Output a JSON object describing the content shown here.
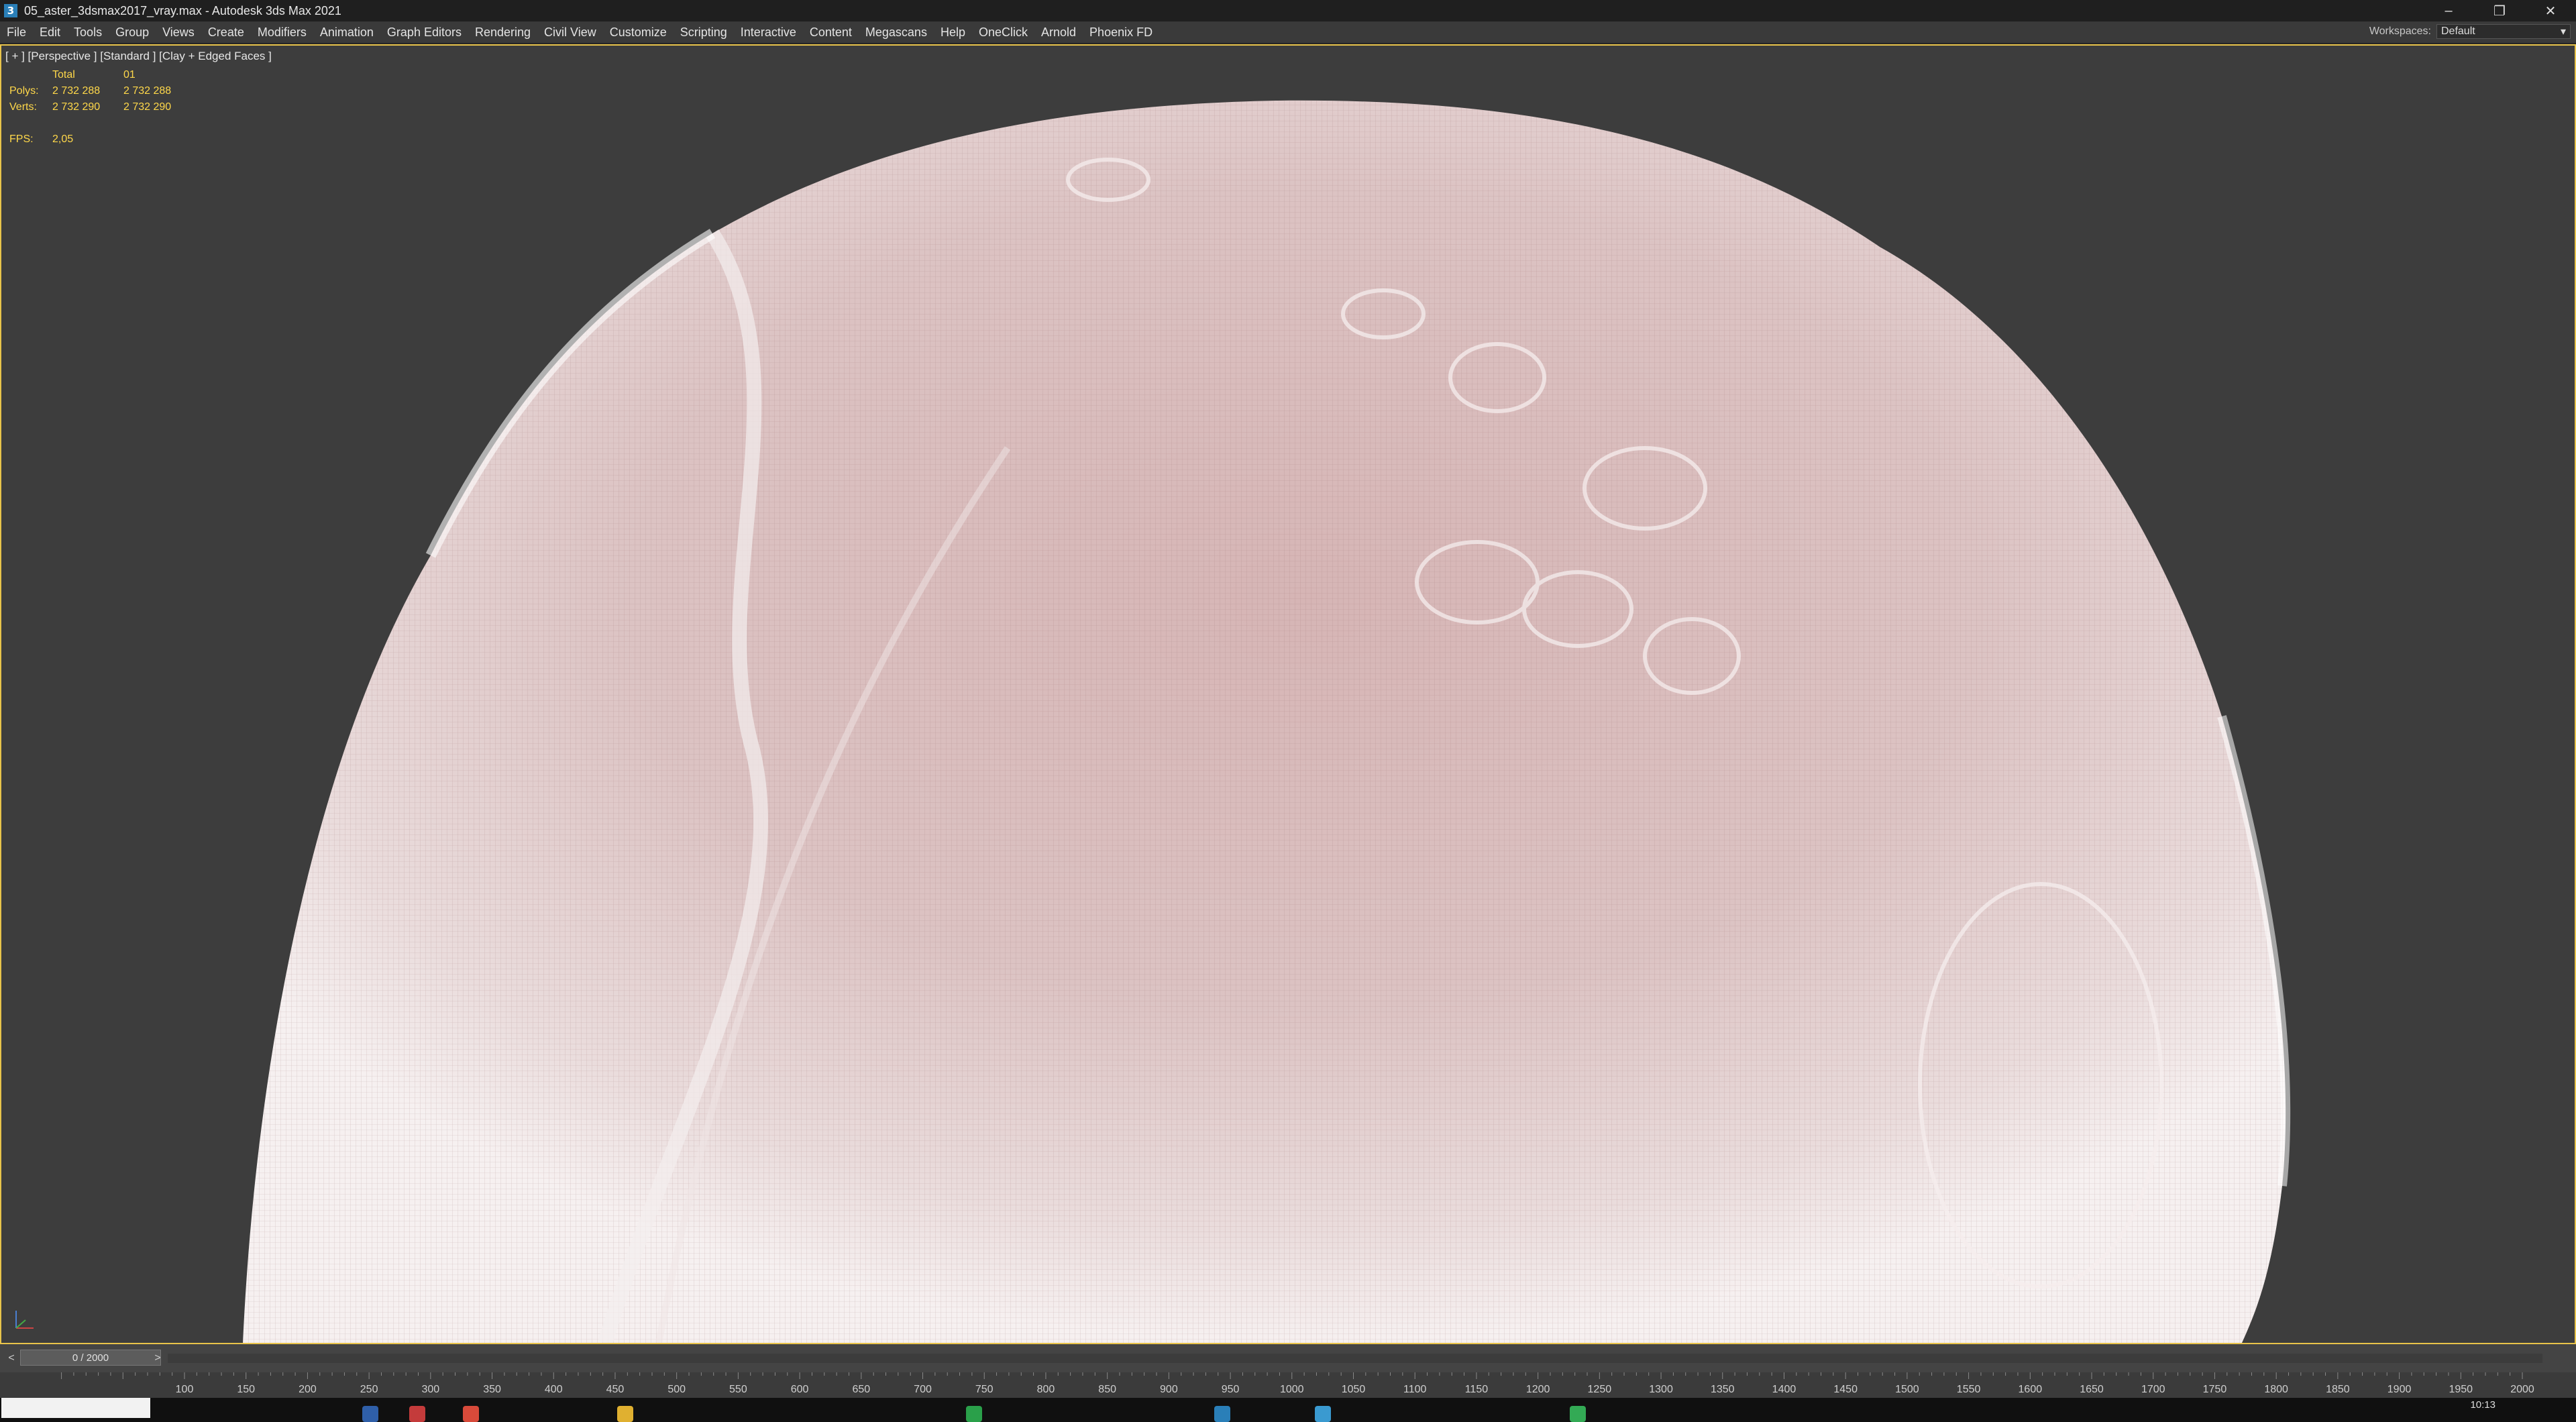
{
  "window": {
    "title": "05_aster_3dsmax2017_vray.max - Autodesk 3ds Max 2021",
    "app_icon_letter": "3",
    "controls": [
      "–",
      "❐",
      "✕"
    ]
  },
  "menubar": {
    "items": [
      "File",
      "Edit",
      "Tools",
      "Group",
      "Views",
      "Create",
      "Modifiers",
      "Animation",
      "Graph Editors",
      "Rendering",
      "Civil View",
      "Customize",
      "Scripting",
      "Interactive",
      "Content",
      "Megascans",
      "Help",
      "OneClick",
      "Arnold",
      "Phoenix FD"
    ],
    "workspaces_label": "Workspaces:",
    "workspace_value": "Default"
  },
  "viewport": {
    "label": "[ + ] [Perspective ] [Standard ] [Clay + Edged Faces ]",
    "stats": {
      "header_total": "Total",
      "header_obj": "01",
      "polys_label": "Polys:",
      "polys_total": "2 732 288",
      "polys_obj": "2 732 288",
      "verts_label": "Verts:",
      "verts_total": "2 732 290",
      "verts_obj": "2 732 290",
      "fps_label": "FPS:",
      "fps_value": "2,05"
    },
    "object_color": "#d8bfbf",
    "background_color": "#3d3d3d",
    "border_color": "#e8c34a"
  },
  "timeline": {
    "frame_readout": "0 / 2000",
    "prev_icon": "arrow-left",
    "next_icon": "arrow-right",
    "ruler_labels": [
      "100",
      "150",
      "200",
      "250",
      "300",
      "350",
      "400",
      "450",
      "500",
      "550",
      "600",
      "650",
      "700",
      "750",
      "800",
      "850",
      "900",
      "950",
      "1000",
      "1050",
      "1100",
      "1150",
      "1200",
      "1250",
      "1300",
      "1350",
      "1400",
      "1450",
      "1500",
      "1550",
      "1600",
      "1650",
      "1700",
      "1750",
      "1800",
      "1850",
      "1900",
      "1950",
      "2000"
    ]
  },
  "taskbar": {
    "clock": "10:13"
  }
}
